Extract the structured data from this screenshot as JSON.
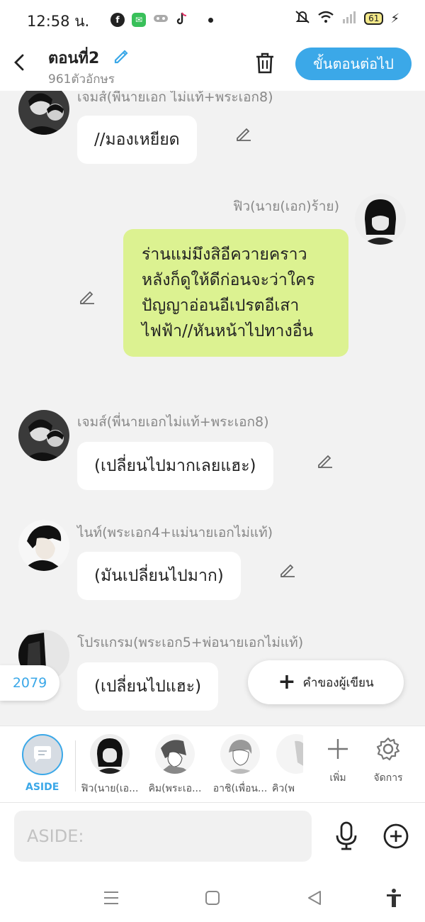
{
  "status_bar": {
    "time": "12:58 น.",
    "battery": "61",
    "apps": [
      "facebook-icon",
      "line-app-icon",
      "game-icon",
      "tiktok-icon"
    ]
  },
  "header": {
    "title": "ตอนที่2",
    "char_count": "961ตัวอักษร",
    "next_label": "ขั้นตอนต่อไป"
  },
  "messages": [
    {
      "speaker": "เจมส์(พี่นายเอก ไม่แท้+พระเอก8)",
      "text": "//มองเหยียด",
      "side": "left"
    },
    {
      "speaker": "ฟิว(นาย(เอก)ร้าย)",
      "text": "ร่านแม่มึงสิอีควายคราวหลังก็ดูให้ดีก่อนจะว่าใครปัญญาอ่อนอีเปรตอีเสาไฟฟ้า//หันหน้าไปทางอื่น",
      "side": "right"
    },
    {
      "speaker": "เจมส์(พี่นายเอกไม่แท้+พระเอก8)",
      "text": "(เปลี่ยนไปมากเลยแฮะ)",
      "side": "left"
    },
    {
      "speaker": "ไนท์(พระเอก4+แม่นายเอกไม่แท้)",
      "text": "(มันเปลี่ยนไปมาก)",
      "side": "left"
    },
    {
      "speaker": "โปรแกรม(พระเอก5+พ่อนายเอกไม่แท้)",
      "text": "(เปลี่ยนไปแฮะ)",
      "side": "left"
    }
  ],
  "counter": "2079",
  "writer_note_label": "คำของผู้เขียน",
  "character_bar": {
    "aside_label": "ASIDE",
    "characters": [
      {
        "label": "ฟิว(นาย(เอ..."
      },
      {
        "label": "คิม(พระเอ..."
      },
      {
        "label": "อาชิ(เพื่อน..."
      },
      {
        "label": "คิว(พ"
      }
    ],
    "add_label": "เพิ่ม",
    "manage_label": "จัดการ"
  },
  "input": {
    "placeholder": "ASIDE:"
  },
  "colors": {
    "accent": "#3ba8e8",
    "my_bubble": "#dcf291",
    "bubble": "#ffffff",
    "background": "#f2f2f2"
  }
}
